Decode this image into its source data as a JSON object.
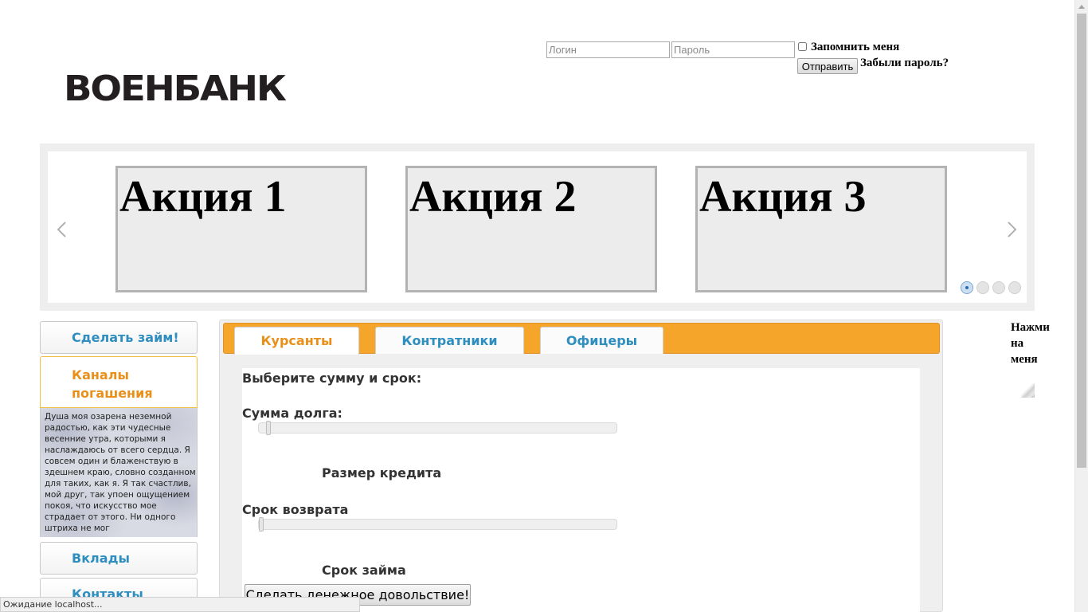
{
  "header": {
    "logo": "ВОЕНБАНК",
    "login_placeholder": "Логин",
    "password_placeholder": "Пароль",
    "remember_label": "Запомнить меня",
    "submit_label": "Отправить",
    "forgot_label": "Забыли пароль?"
  },
  "slider": {
    "slides": [
      "Акция 1",
      "Акция 2",
      "Акция 3"
    ],
    "active_dot": 1,
    "dot_count": 4,
    "prev_icon": "chevron-left-icon",
    "next_icon": "chevron-right-icon"
  },
  "menu": {
    "items": [
      "Сделать займ!",
      "Каналы погашения",
      "Вклады",
      "Контакты"
    ],
    "active_index": 1,
    "panel_text": "Душа моя озарена неземной радостью, как эти чудесные весенние утра, которыми я наслаждаюсь от всего сердца. Я совсем один и блаженствую в здешнем краю, словно созданном для таких, как я. Я так счастлив, мой друг, так упоен ощущением покоя, что искусство мое страдает от этого. Ни одного штриха не мог"
  },
  "calculator": {
    "tabs": [
      "Курсанты",
      "Контратники",
      "Офицеры"
    ],
    "active_tab": 0,
    "heading": "Выберите сумму и срок:",
    "amount_label": "Сумма долга:",
    "amount_caption": "Размер кредита",
    "amount_position": 0.02,
    "term_label": "Срок возврата",
    "term_caption": "Срок займа",
    "term_position": 0.0,
    "submit_label": "Сделать денежное довольствие!"
  },
  "aside": {
    "text_lines": [
      "Нажми",
      "на",
      "меня"
    ]
  },
  "status": {
    "text": "Ожидание localhost..."
  },
  "colors": {
    "accent_orange": "#f5a62a",
    "link_blue": "#2f8ec0",
    "active_orange_text": "#e8901a"
  }
}
